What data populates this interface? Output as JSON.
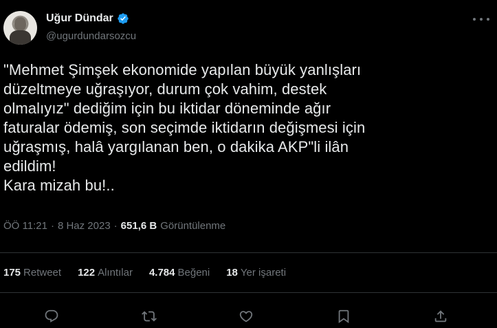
{
  "author": {
    "display_name": "Uğur Dündar",
    "handle": "@ugurdundarsozcu",
    "verified_icon": "verified-badge-icon",
    "avatar_icon": "avatar"
  },
  "tweet": {
    "text": "\"Mehmet Şimşek ekonomide yapılan büyük yanlışları\ndüzeltmeye uğraşıyor, durum çok vahim, destek\nolmalıyız\" dediğim için bu iktidar döneminde ağır\nfaturalar ödemiş, son seçimde iktidarın değişmesi için\nuğraşmış, halâ yargılanan ben, o dakika AKP\"li ilân\nedildim!\nKara mizah bu!.."
  },
  "meta": {
    "time": "ÖÖ 11:21",
    "separator": "·",
    "date": "8 Haz 2023",
    "separator2": "·",
    "views_count": "651,6 B",
    "views_label": "Görüntülenme"
  },
  "stats": [
    {
      "count": "175",
      "label": "Retweet"
    },
    {
      "count": "122",
      "label": "Alıntılar"
    },
    {
      "count": "4.784",
      "label": "Beğeni"
    },
    {
      "count": "18",
      "label": "Yer işareti"
    }
  ],
  "actions": {
    "reply_icon": "reply-icon",
    "retweet_icon": "retweet-icon",
    "like_icon": "like-icon",
    "bookmark_icon": "bookmark-icon",
    "share_icon": "share-icon"
  },
  "colors": {
    "background": "#000000",
    "text": "#e7e9ea",
    "muted": "#71767b",
    "divider": "#2f3336",
    "verified": "#1d9bf0"
  }
}
